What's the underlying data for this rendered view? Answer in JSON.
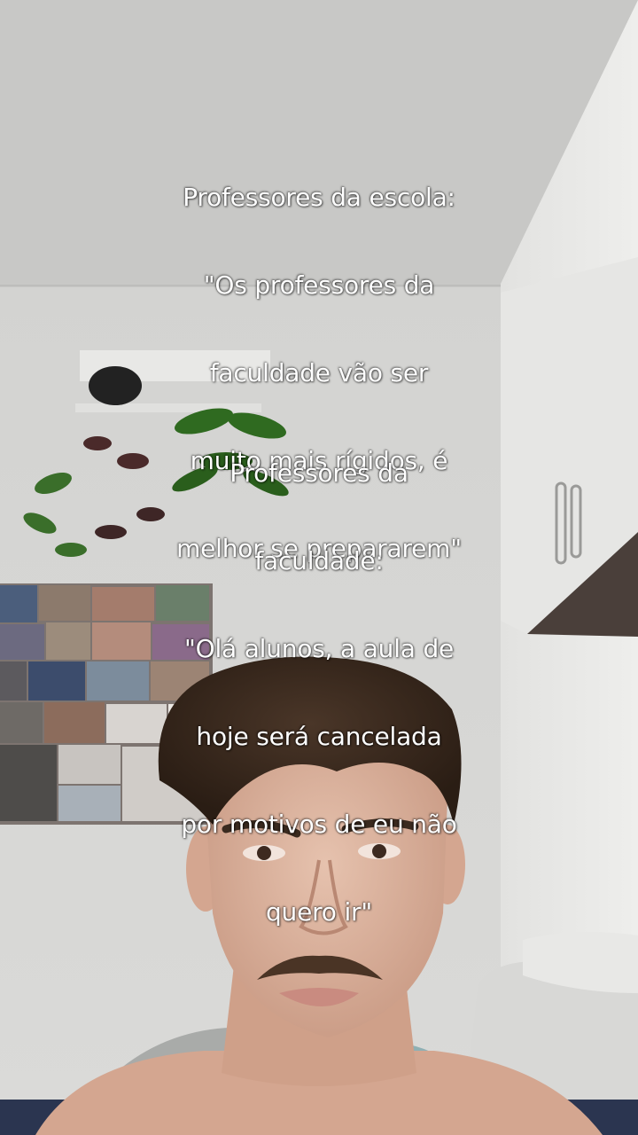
{
  "caption": {
    "block1_lines": [
      "Professores da escola:",
      "\"Os professores da",
      "faculdade vão ser",
      "muito mais rígidos, é",
      "melhor se prepararem\""
    ],
    "block2_lines": [
      "Professores da",
      "faculdade:",
      "\"Olá alunos, a aula de",
      "hoje será cancelada",
      "por motivos de eu não",
      "quero ir\""
    ]
  },
  "scene": {
    "wall_color": "#d6d6d4",
    "ceiling_color": "#cdcdcb",
    "cabinet_color": "#e4e4e2",
    "hair_color": "#3a2a1f",
    "skin_color": "#dcb5a0"
  }
}
